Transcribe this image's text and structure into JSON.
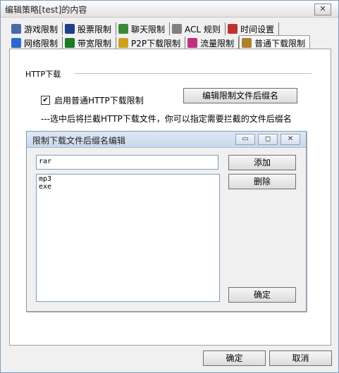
{
  "window": {
    "title": "编辑策略[test]的内容",
    "close_glyph": "✕"
  },
  "tabs_row1": [
    {
      "label": "游戏限制",
      "icon": "game-icon",
      "color": "#4a6aa8"
    },
    {
      "label": "股票限制",
      "icon": "stock-icon",
      "color": "#1f3f8a"
    },
    {
      "label": "聊天限制",
      "icon": "chat-icon",
      "color": "#3a8a3a"
    },
    {
      "label": "ACL 规则",
      "icon": "acl-icon",
      "color": "#808080"
    },
    {
      "label": "时间设置",
      "icon": "clock-icon",
      "color": "#c03030"
    }
  ],
  "tabs_row2": [
    {
      "label": "网络限制",
      "icon": "network-icon",
      "color": "#2a6acb"
    },
    {
      "label": "带宽限制",
      "icon": "bandwidth-icon",
      "color": "#1a7a2a"
    },
    {
      "label": "P2P下载限制",
      "icon": "p2p-icon",
      "color": "#d0a020"
    },
    {
      "label": "流量限制",
      "icon": "traffic-icon",
      "color": "#c03080"
    },
    {
      "label": "普通下载限制",
      "icon": "download-icon",
      "color": "#b08030",
      "selected": true
    }
  ],
  "http": {
    "group_label": "HTTP下载",
    "checkbox_label": "启用普通HTTP下载限制",
    "checkbox_checked": true,
    "check_glyph": "✔",
    "edit_button": "编辑限制文件后缀名",
    "hint": "---选中后将拦截HTTP下载文件，你可以指定需要拦截的文件后缀名"
  },
  "dialog": {
    "title": "限制下载文件后缀名编辑",
    "minimize_glyph": "▭",
    "maximize_glyph": "◻",
    "close_glyph": "✕",
    "input_value": "rar",
    "add_button": "添加",
    "delete_button": "删除",
    "ok_button": "确定",
    "extensions": [
      "mp3",
      "exe"
    ]
  },
  "footer": {
    "ok": "确定",
    "cancel": "取消"
  }
}
